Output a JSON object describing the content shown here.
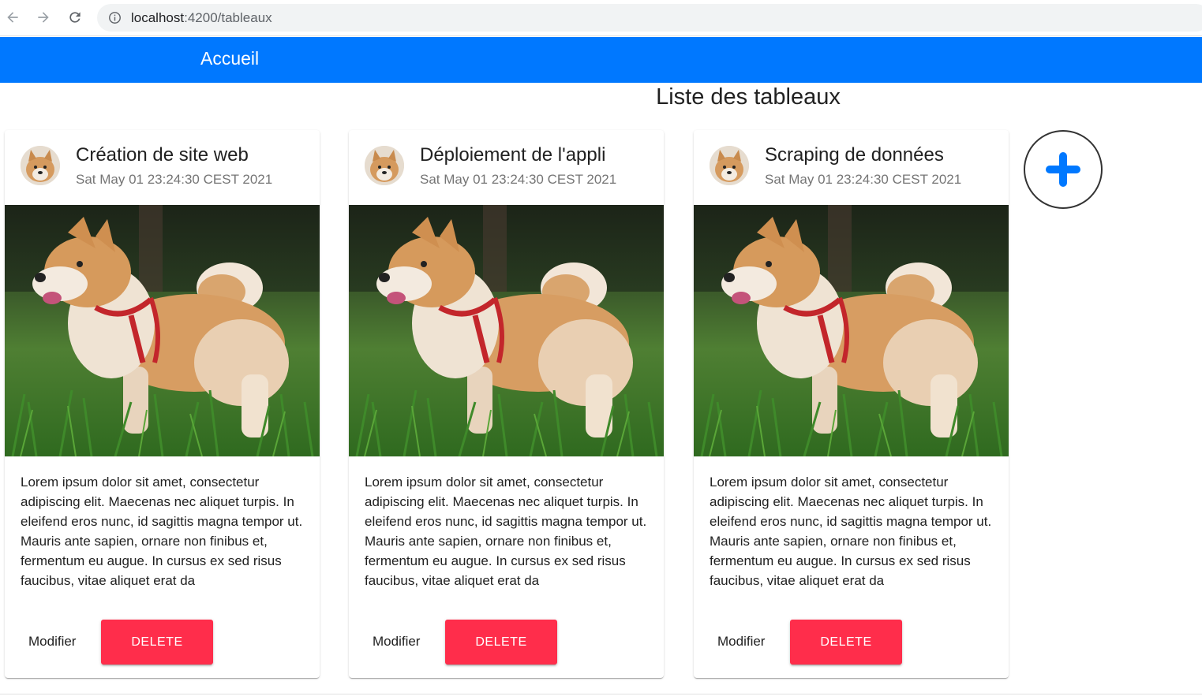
{
  "browser": {
    "url_host": "localhost",
    "url_path": ":4200/tableaux"
  },
  "navbar": {
    "home_label": "Accueil",
    "background_color": "#0078ff"
  },
  "page": {
    "title": "Liste des tableaux"
  },
  "cards": [
    {
      "title": "Création de site web",
      "subtitle": "Sat May 01 23:24:30 CEST 2021",
      "text": "Lorem ipsum dolor sit amet, consectetur adipiscing elit. Maecenas nec aliquet turpis. In eleifend eros nunc, id sagittis magna tempor ut. Mauris ante sapien, ornare non finibus et, fermentum eu augue. In cursus ex sed risus faucibus, vitae aliquet erat da",
      "modify_label": "Modifier",
      "delete_label": "DELETE"
    },
    {
      "title": "Déploiement de l'appli",
      "subtitle": "Sat May 01 23:24:30 CEST 2021",
      "text": "Lorem ipsum dolor sit amet, consectetur adipiscing elit. Maecenas nec aliquet turpis. In eleifend eros nunc, id sagittis magna tempor ut. Mauris ante sapien, ornare non finibus et, fermentum eu augue. In cursus ex sed risus faucibus, vitae aliquet erat da",
      "modify_label": "Modifier",
      "delete_label": "DELETE"
    },
    {
      "title": "Scraping de données",
      "subtitle": "Sat May 01 23:24:30 CEST 2021",
      "text": "Lorem ipsum dolor sit amet, consectetur adipiscing elit. Maecenas nec aliquet turpis. In eleifend eros nunc, id sagittis magna tempor ut. Mauris ante sapien, ornare non finibus et, fermentum eu augue. In cursus ex sed risus faucibus, vitae aliquet erat da",
      "modify_label": "Modifier",
      "delete_label": "DELETE"
    }
  ],
  "colors": {
    "delete_button": "#ff2d4b",
    "add_icon": "#0078ff"
  },
  "icons": {
    "back": "arrow-left-icon",
    "forward": "arrow-right-icon",
    "reload": "reload-icon",
    "site_info": "info-icon",
    "add": "plus-icon",
    "avatar": "shiba-dog-avatar",
    "card_image": "shiba-dog-photo"
  }
}
